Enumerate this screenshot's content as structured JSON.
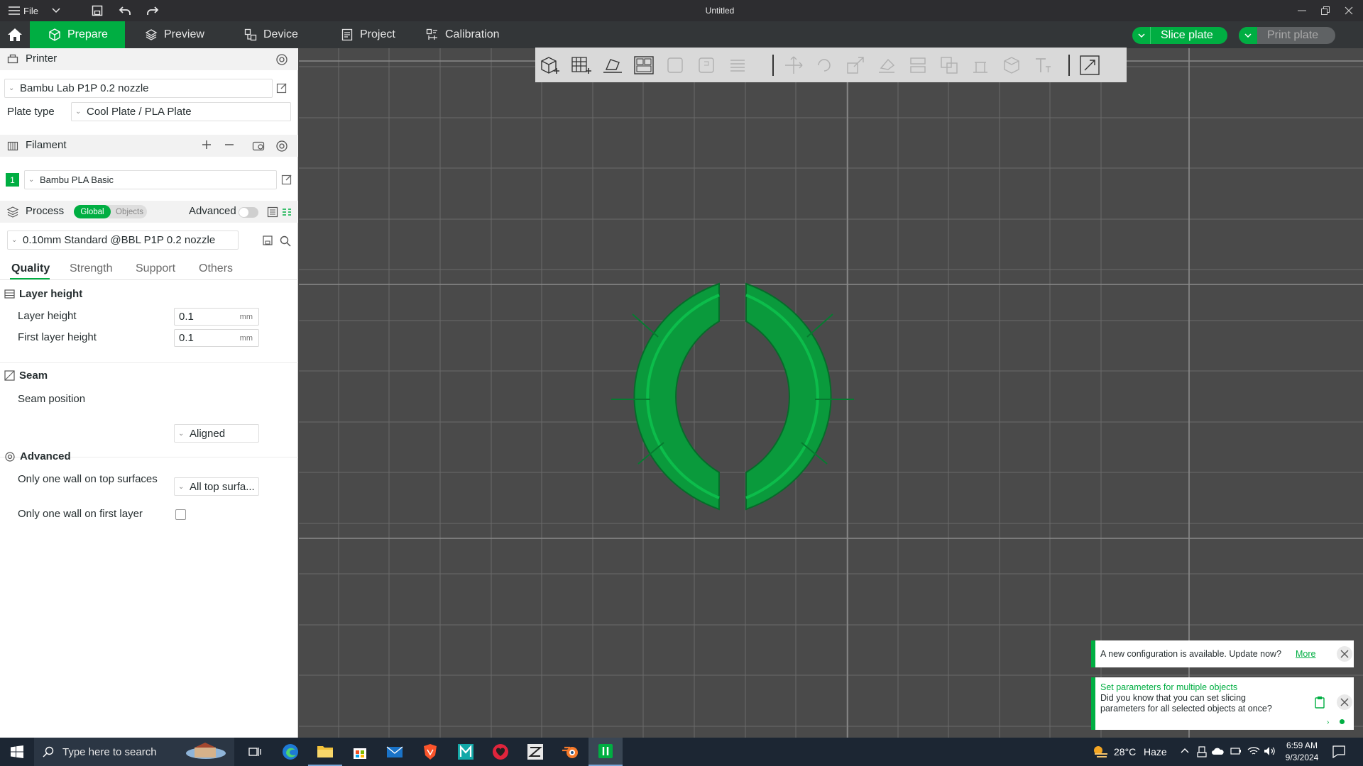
{
  "window": {
    "title": "Untitled",
    "file_menu": "File"
  },
  "tabs": [
    {
      "label": "Prepare",
      "icon": "cube-icon"
    },
    {
      "label": "Preview",
      "icon": "layers-icon"
    },
    {
      "label": "Device",
      "icon": "device-icon"
    },
    {
      "label": "Project",
      "icon": "project-icon"
    },
    {
      "label": "Calibration",
      "icon": "calibration-icon"
    }
  ],
  "actions": {
    "slice": "Slice plate",
    "print": "Print plate"
  },
  "printer": {
    "section": "Printer",
    "name": "Bambu Lab P1P 0.2 nozzle",
    "plate_type_label": "Plate type",
    "plate_type": "Cool Plate / PLA Plate"
  },
  "filament": {
    "section": "Filament",
    "slot": "1",
    "name": "Bambu PLA Basic",
    "color": "#00ae42"
  },
  "process": {
    "section": "Process",
    "global": "Global",
    "objects": "Objects",
    "advanced_label": "Advanced",
    "advanced_on": false,
    "preset": "0.10mm Standard @BBL P1P 0.2 nozzle",
    "tabs": [
      "Quality",
      "Strength",
      "Support",
      "Others"
    ],
    "groups": {
      "layer_height": {
        "title": "Layer height",
        "layer_height_label": "Layer height",
        "layer_height": "0.1",
        "first_layer_label": "First layer height",
        "first_layer": "0.1",
        "unit": "mm"
      },
      "seam": {
        "title": "Seam",
        "position_label": "Seam position",
        "position": "Aligned"
      },
      "advanced": {
        "title": "Advanced",
        "one_wall_top_label": "Only one wall on top surfaces",
        "one_wall_top": "All top surfa...",
        "one_wall_first_label": "Only one wall on first layer",
        "one_wall_first": false
      }
    }
  },
  "toasts": {
    "config": {
      "text": "A new configuration is available. Update now?",
      "link": "More"
    },
    "tip": {
      "title": "Set parameters for multiple objects",
      "body": "Did you know that you can set slicing parameters for all selected objects at once?"
    }
  },
  "taskbar": {
    "search_placeholder": "Type here to search",
    "weather": {
      "temp": "28°C",
      "condition": "Haze"
    },
    "time": "6:59 AM",
    "date": "9/3/2024"
  },
  "colors": {
    "accent": "#00ae42",
    "model": "#0a9a3c",
    "plate": "#4a4a4a"
  }
}
